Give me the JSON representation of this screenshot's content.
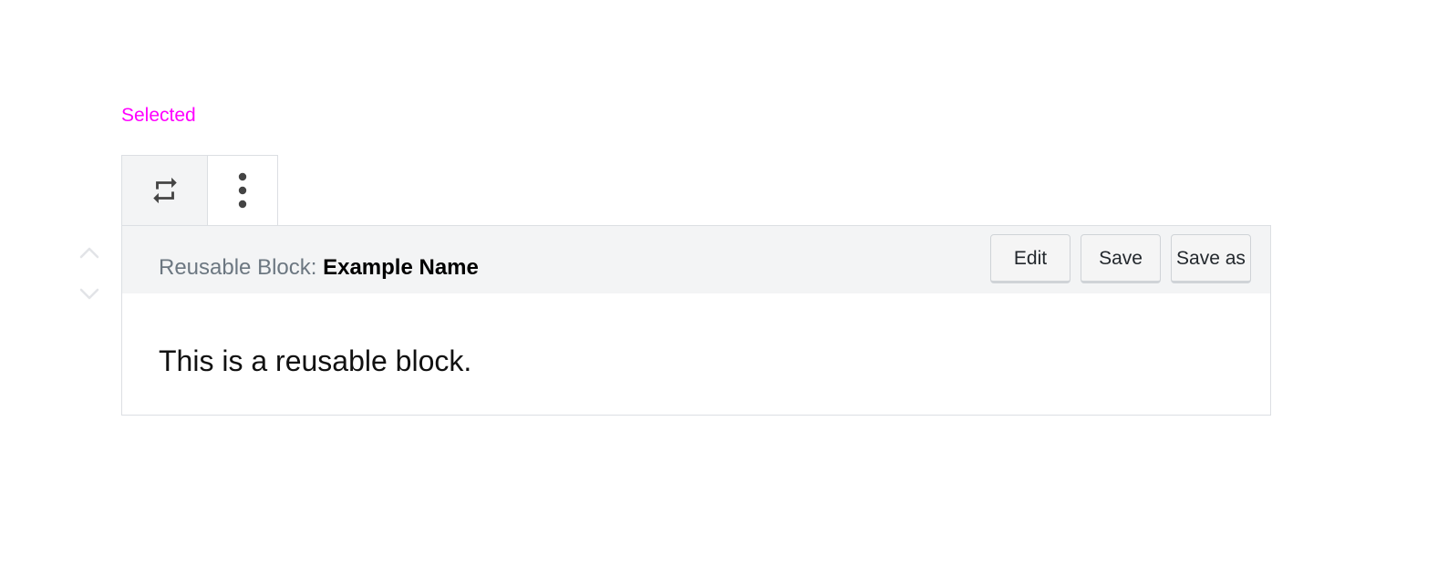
{
  "state_label": "Selected",
  "colors": {
    "state_label": "#ff00ff",
    "toolbar_bg": "#f3f4f5",
    "border": "#dcdfe3",
    "muted_text": "#6c7781"
  },
  "toolbar": {
    "switcher_icon": "reusable-block-icon",
    "more_icon": "more-vertical-icon"
  },
  "mover": {
    "up_icon": "chevron-up-icon",
    "down_icon": "chevron-down-icon"
  },
  "block": {
    "title_prefix": "Reusable Block: ",
    "title_name": "Example Name",
    "actions": {
      "edit": "Edit",
      "save": "Save",
      "save_as": "Save as"
    },
    "content": "This is a reusable block."
  }
}
